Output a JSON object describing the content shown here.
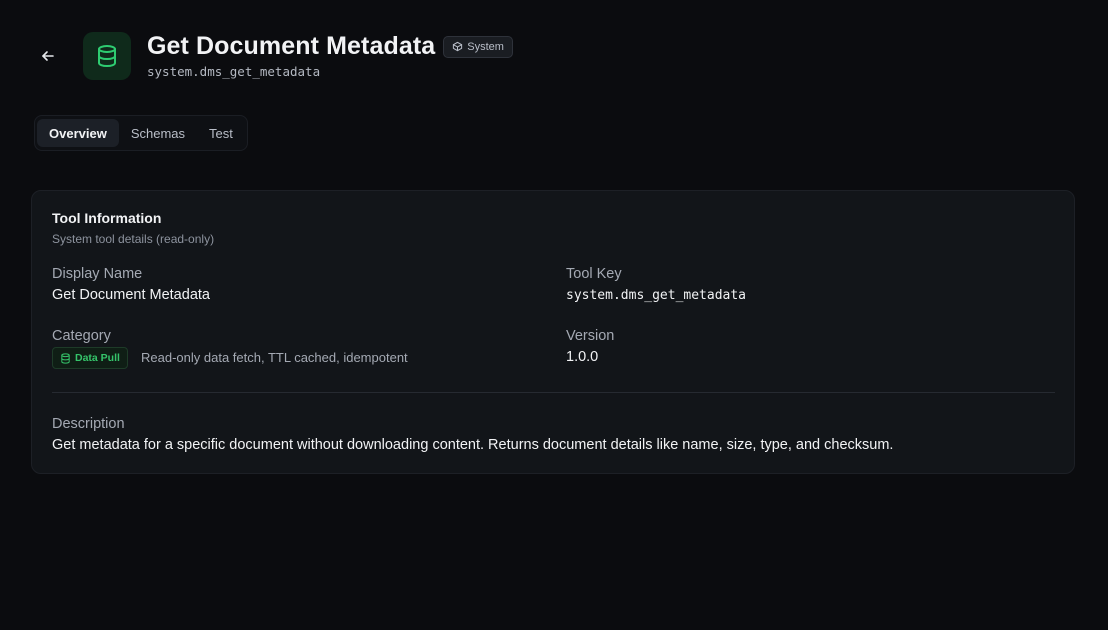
{
  "header": {
    "title": "Get Document Metadata",
    "badge": "System",
    "key": "system.dms_get_metadata",
    "icon": "database-icon",
    "accent": "#2ecc71"
  },
  "tabs": [
    {
      "label": "Overview",
      "active": true
    },
    {
      "label": "Schemas",
      "active": false
    },
    {
      "label": "Test",
      "active": false
    }
  ],
  "card": {
    "title": "Tool Information",
    "subtitle": "System tool details (read-only)",
    "display_name_label": "Display Name",
    "display_name": "Get Document Metadata",
    "tool_key_label": "Tool Key",
    "tool_key": "system.dms_get_metadata",
    "category_label": "Category",
    "category_badge": "Data Pull",
    "category_desc": "Read-only data fetch, TTL cached, idempotent",
    "version_label": "Version",
    "version": "1.0.0",
    "description_label": "Description",
    "description": "Get metadata for a specific document without downloading content. Returns document details like name, size, type, and checksum."
  }
}
